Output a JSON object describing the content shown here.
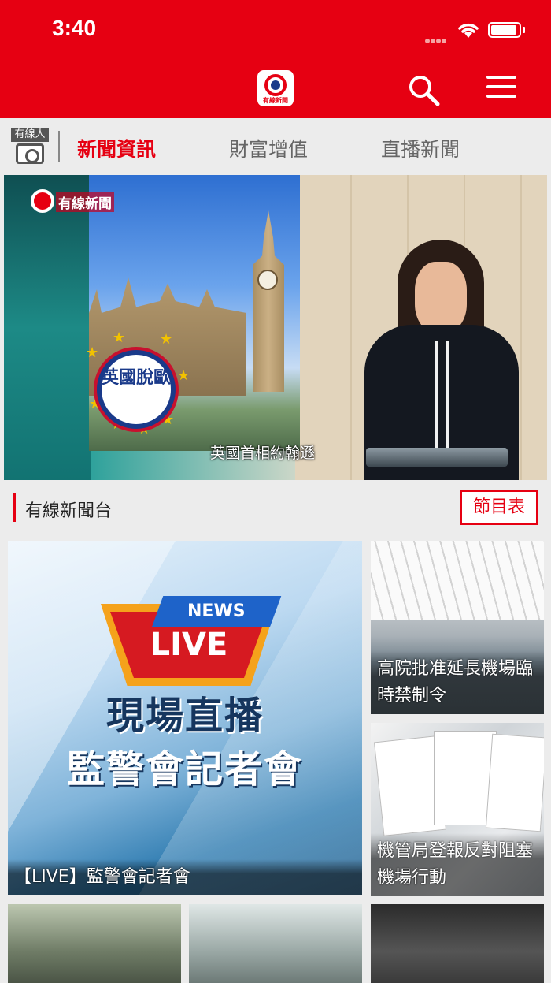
{
  "status_bar": {
    "time": "3:40"
  },
  "header": {
    "logo_text": "有線新聞"
  },
  "tabs": {
    "camera_label": "有線人",
    "items": [
      {
        "label": "新聞資訊",
        "active": true
      },
      {
        "label": "財富增值",
        "active": false
      },
      {
        "label": "直播新聞",
        "active": false
      }
    ]
  },
  "hero": {
    "channel_logo": "有線新聞",
    "badge": "英國脫歐",
    "caption": "英國首相約翰遜"
  },
  "section": {
    "title": "有線新聞台",
    "schedule_button": "節目表"
  },
  "cards": {
    "live": {
      "news_tag": "NEWS",
      "live_tag": "LIVE",
      "headline_1": "現場直播",
      "headline_2": "監警會記者會",
      "title": "【LIVE】監警會記者會"
    },
    "airport": {
      "title": "高院批准延長機場臨時禁制令"
    },
    "paper": {
      "title": "機管局登報反對阻塞機場行動"
    }
  },
  "colors": {
    "brand_red": "#e60012",
    "navy": "#1a3a8a"
  }
}
